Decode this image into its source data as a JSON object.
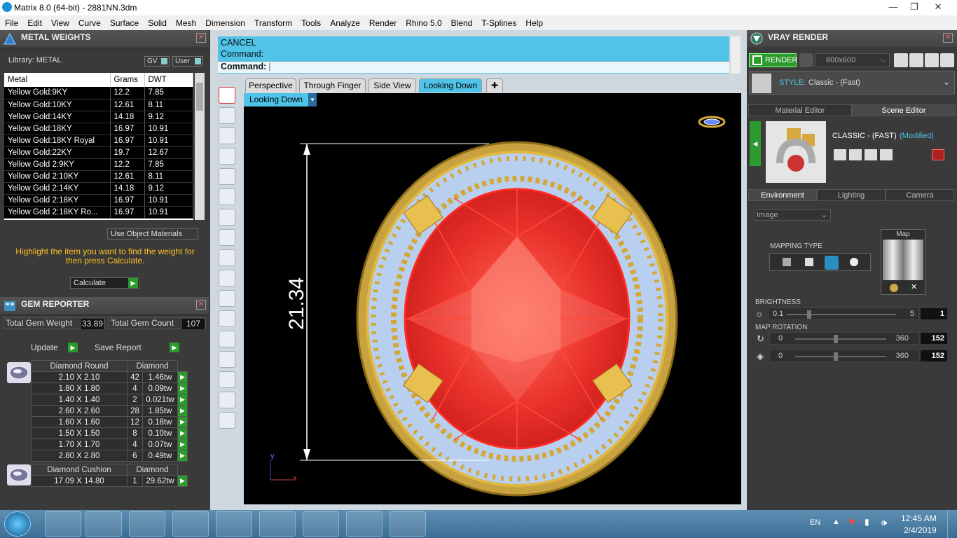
{
  "window": {
    "title": "Matrix 8.0 (64-bit) - 2881NN.3dm"
  },
  "menu": [
    "File",
    "Edit",
    "View",
    "Curve",
    "Surface",
    "Solid",
    "Mesh",
    "Dimension",
    "Transform",
    "Tools",
    "Analyze",
    "Render",
    "Rhino 5.0",
    "Blend",
    "T-Splines",
    "Help"
  ],
  "metal_panel": {
    "title": "METAL WEIGHTS",
    "library_label": "Library: METAL",
    "gv_label": "GV",
    "user_label": "User",
    "columns": [
      "Metal",
      "Grams",
      "DWT"
    ],
    "rows": [
      [
        "Yellow Gold:9KY",
        "12.2",
        "7.85"
      ],
      [
        "Yellow Gold:10KY",
        "12.61",
        "8.11"
      ],
      [
        "Yellow Gold:14KY",
        "14.18",
        "9.12"
      ],
      [
        "Yellow Gold:18KY",
        "16.97",
        "10.91"
      ],
      [
        "Yellow Gold:18KY Royal",
        "16.97",
        "10.91"
      ],
      [
        "Yellow Gold:22KY",
        "19.7",
        "12.67"
      ],
      [
        "Yellow Gold 2:9KY",
        "12.2",
        "7.85"
      ],
      [
        "Yellow Gold 2:10KY",
        "12.61",
        "8.11"
      ],
      [
        "Yellow Gold 2:14KY",
        "14.18",
        "9.12"
      ],
      [
        "Yellow Gold 2:18KY",
        "16.97",
        "10.91"
      ],
      [
        "Yellow Gold 2:18KY Ro...",
        "16.97",
        "10.91"
      ]
    ],
    "use_object_materials": "Use Object Materials",
    "hint": "Highlight the item you want to find the weight for then press Calculate.",
    "calculate": "Calculate"
  },
  "gem_panel": {
    "title": "GEM REPORTER",
    "total_weight_label": "Total Gem Weight",
    "total_weight": "33.89",
    "total_count_label": "Total Gem Count",
    "total_count": "107",
    "update": "Update",
    "save_report": "Save Report",
    "round_header": [
      "Diamond Round",
      "Diamond"
    ],
    "round_rows": [
      [
        "2.10 X 2.10",
        "42",
        "1.46tw"
      ],
      [
        "1.80 X 1.80",
        "4",
        "0.09tw"
      ],
      [
        "1.40 X 1.40",
        "2",
        "0.021tw"
      ],
      [
        "2.60 X 2.60",
        "28",
        "1.85tw"
      ],
      [
        "1.60 X 1.60",
        "12",
        "0.18tw"
      ],
      [
        "1.50 X 1.50",
        "8",
        "0.10tw"
      ],
      [
        "1.70 X 1.70",
        "4",
        "0.07tw"
      ],
      [
        "2.80 X 2.80",
        "6",
        "0.49tw"
      ]
    ],
    "cushion_header": [
      "Diamond Cushion",
      "Diamond"
    ],
    "cushion_rows": [
      [
        "17.09 X 14.80",
        "1",
        "29.62tw"
      ]
    ]
  },
  "command": {
    "line1": "CANCEL",
    "line2": "Command:",
    "line3": "Command:"
  },
  "viewtabs": [
    "Perspective",
    "Through Finger",
    "Side View",
    "Looking Down"
  ],
  "viewport": {
    "label": "Looking Down",
    "dimension": "21.34",
    "axis_y": "y",
    "axis_x": "x"
  },
  "vray": {
    "title": "VRAY RENDER",
    "render": "RENDER",
    "resolution": "800x600",
    "style_label": "STYLE:",
    "style_value": "Classic - (Fast)",
    "tabs": [
      "Material Editor",
      "Scene Editor"
    ],
    "scene_name": "CLASSIC - (FAST)",
    "scene_modified": "(Modified)",
    "env_tabs": [
      "Environment",
      "Lighting",
      "Camera"
    ],
    "image_select": "Image",
    "mapping_type": "MAPPING TYPE",
    "map_label": "Map",
    "brightness_label": "BRIGHTNESS",
    "brightness_min": "0.1",
    "brightness_max": "5",
    "brightness_value": "1",
    "map_rotation_label": "MAP ROTATION",
    "rot1_min": "0",
    "rot1_max": "360",
    "rot1_value": "152",
    "rot2_min": "0",
    "rot2_max": "360",
    "rot2_value": "152"
  },
  "taskbar": {
    "lang": "EN",
    "time": "12:45 AM",
    "date": "2/4/2019"
  }
}
